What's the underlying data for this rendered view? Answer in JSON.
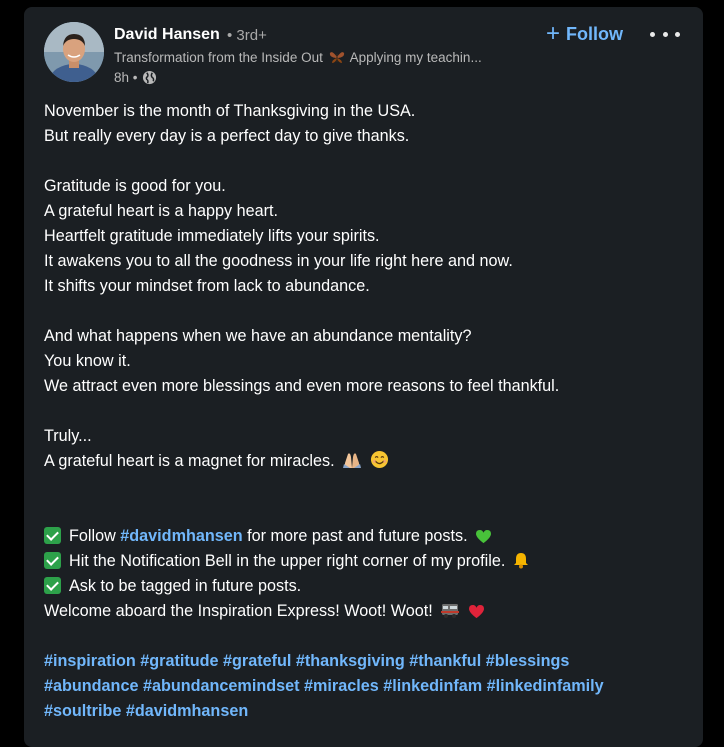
{
  "author": {
    "name": "David Hansen",
    "degree": "• 3rd+",
    "headline": "Transformation from the Inside Out",
    "headline_tail": "Applying my teachin...",
    "time": "8h •"
  },
  "actions": {
    "follow_label": "Follow",
    "follow_icon": "plus-icon",
    "more_icon": "more-options-icon"
  },
  "post": {
    "lines": [
      "November is the month of Thanksgiving in the USA.",
      "But really every day is a perfect day to give thanks.",
      "Gratitude is good for you.",
      "A grateful heart is a happy heart.",
      "Heartfelt gratitude immediately lifts your spirits.",
      "It awakens you to all the goodness in your life right here and now.",
      "It shifts your mindset from lack to abundance.",
      "And what happens when we have an abundance mentality?",
      "You know it.",
      "We attract even more blessings and even more reasons to feel thankful.",
      "Truly...",
      "A grateful heart is a magnet for miracles."
    ],
    "follow_prefix": "Follow ",
    "follow_hashtag": "#davidmhansen",
    "follow_suffix": " for more past and future posts.",
    "bell_line": "Hit the Notification Bell in the upper right corner of my profile.",
    "tag_line": "Ask to be tagged in future posts.",
    "welcome_line": "Welcome aboard the Inspiration Express! Woot! Woot!"
  },
  "hashtags": {
    "line1": [
      "#inspiration",
      "#gratitude",
      "#grateful",
      "#thanksgiving",
      "#thankful",
      "#blessings"
    ],
    "line2": [
      "#abundance",
      "#abundancemindset",
      "#miracles",
      "#linkedinfam",
      "#linkedinfamily"
    ],
    "line3": [
      "#soultribe",
      "#davidmhansen"
    ]
  },
  "colors": {
    "background": "#000000",
    "card": "#1b1f23",
    "link": "#71b7fb",
    "text": "#ffffff",
    "muted": "#b9b9b9"
  }
}
